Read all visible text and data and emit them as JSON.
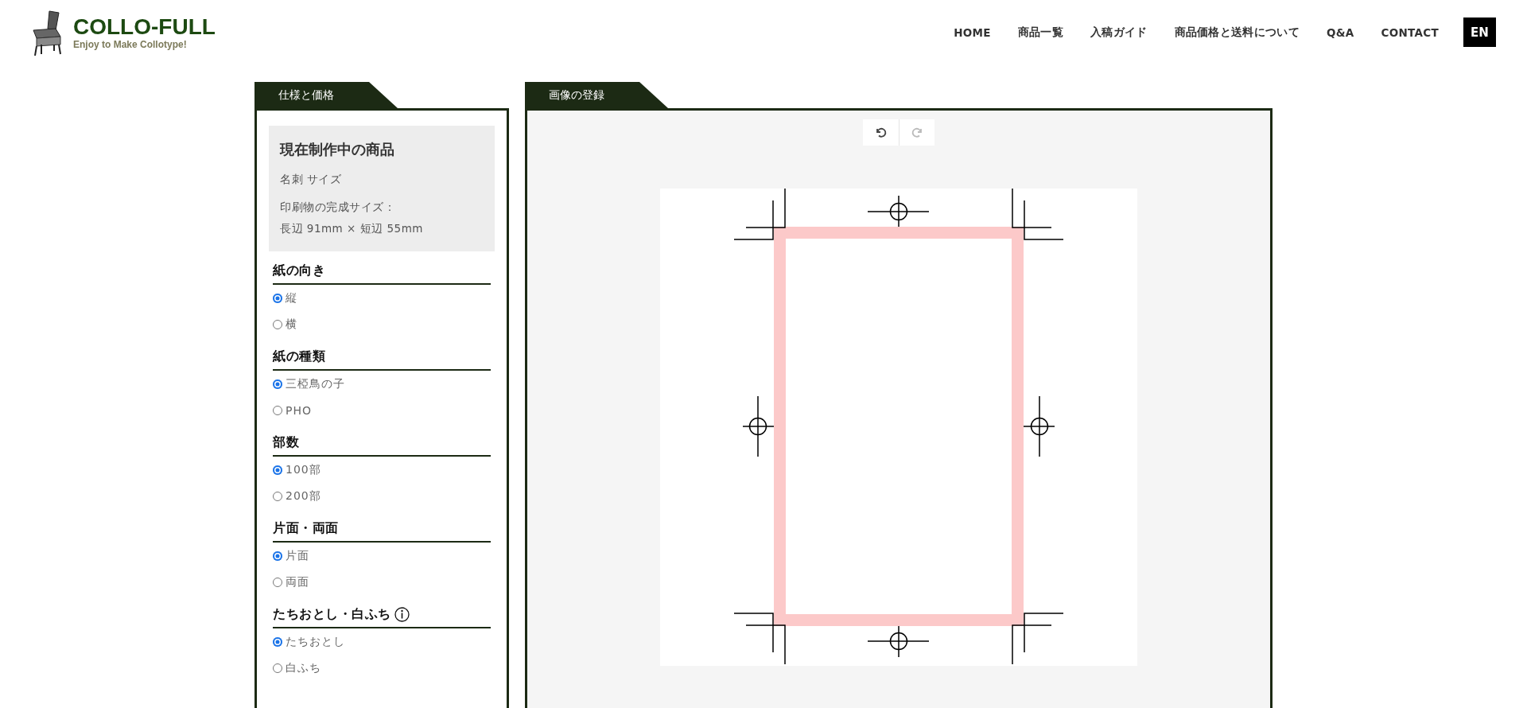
{
  "header": {
    "logo": {
      "title": "COLLO-FULL",
      "tagline": "Enjoy to Make Collotype!"
    },
    "nav": [
      {
        "label": "HOME"
      },
      {
        "label": "商品一覧"
      },
      {
        "label": "入稿ガイド"
      },
      {
        "label": "商品価格と送料について"
      },
      {
        "label": "Q&A"
      },
      {
        "label": "CONTACT"
      }
    ],
    "language_button": "EN"
  },
  "spec_panel": {
    "tab": "仕様と価格",
    "current_product": {
      "heading": "現在制作中の商品",
      "name": "名刺 サイズ",
      "size_label": "印刷物の完成サイズ：",
      "size": "長辺 91mm × 短辺 55mm"
    },
    "groups": [
      {
        "title": "紙の向き",
        "has_info": false,
        "options": [
          {
            "label": "縦",
            "selected": true
          },
          {
            "label": "横",
            "selected": false
          }
        ]
      },
      {
        "title": "紙の種類",
        "has_info": false,
        "options": [
          {
            "label": "三椏鳥の子",
            "selected": true
          },
          {
            "label": "PHO",
            "selected": false
          }
        ]
      },
      {
        "title": "部数",
        "has_info": false,
        "options": [
          {
            "label": "100部",
            "selected": true
          },
          {
            "label": "200部",
            "selected": false
          }
        ]
      },
      {
        "title": "片面・両面",
        "has_info": false,
        "options": [
          {
            "label": "片面",
            "selected": true
          },
          {
            "label": "両面",
            "selected": false
          }
        ]
      },
      {
        "title": "たちおとし・白ふち",
        "has_info": true,
        "options": [
          {
            "label": "たちおとし",
            "selected": true
          },
          {
            "label": "白ふち",
            "selected": false
          }
        ]
      }
    ]
  },
  "image_panel": {
    "tab": "画像の登録",
    "toolbar": [
      {
        "kind": "undo",
        "disabled": false
      },
      {
        "kind": "redo",
        "disabled": true
      }
    ]
  }
}
